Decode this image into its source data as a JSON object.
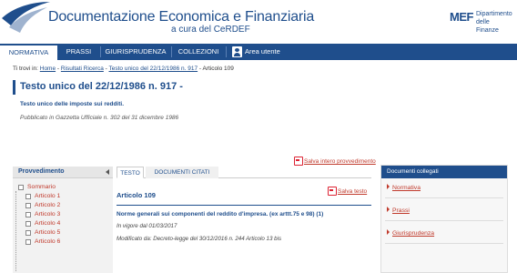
{
  "header": {
    "title": "Documentazione Economica e Finanziaria",
    "subtitle": "a cura del CeRDEF",
    "mef_mark": "MEF",
    "mef_line1": "Dipartimento",
    "mef_line2": "delle Finanze"
  },
  "nav": {
    "items": [
      "NORMATIVA",
      "PRASSI",
      "GIURISPRUDENZA",
      "COLLEZIONI",
      "Area utente"
    ],
    "active": "NORMATIVA"
  },
  "breadcrumb": {
    "prefix": "Ti trovi in:",
    "home": "Home",
    "results": "Risultati Ricerca",
    "doc": "Testo unico del 22/12/1986 n. 917",
    "current": "Articolo 109",
    "sep": " - "
  },
  "document": {
    "title": "Testo unico del 22/12/1986 n. 917 -",
    "subtitle": "Testo unico delle imposte sui redditi.",
    "publication": "Pubblicato in Gazzetta Ufficiale n. 302 del 31 dicembre 1986",
    "save_all": "Salva intero provvedimento"
  },
  "left_panel": {
    "header": "Provvedimento",
    "root": "Sommario",
    "items": [
      "Articolo 1",
      "Articolo 2",
      "Articolo 3",
      "Articolo 4",
      "Articolo 5",
      "Articolo 6"
    ]
  },
  "tabs": [
    "TESTO",
    "DOCUMENTI CITATI"
  ],
  "article": {
    "title": "Articolo 109",
    "save": "Salva testo",
    "heading": "Norme generali sui componenti del reddito d'impresa. (ex arttt.75 e 98)  (1)",
    "in_force": "In vigore dal 01/03/2017",
    "modified": "Modificato da: Decreto-legge del 30/12/2016 n. 244 Articolo 13 bis"
  },
  "right_panel": {
    "header": "Documenti collegati",
    "items": [
      "Normativa",
      "Prassi",
      "Giurisprudenza"
    ]
  },
  "colors": {
    "brand": "#1f4e8c",
    "link": "#c0392b"
  }
}
